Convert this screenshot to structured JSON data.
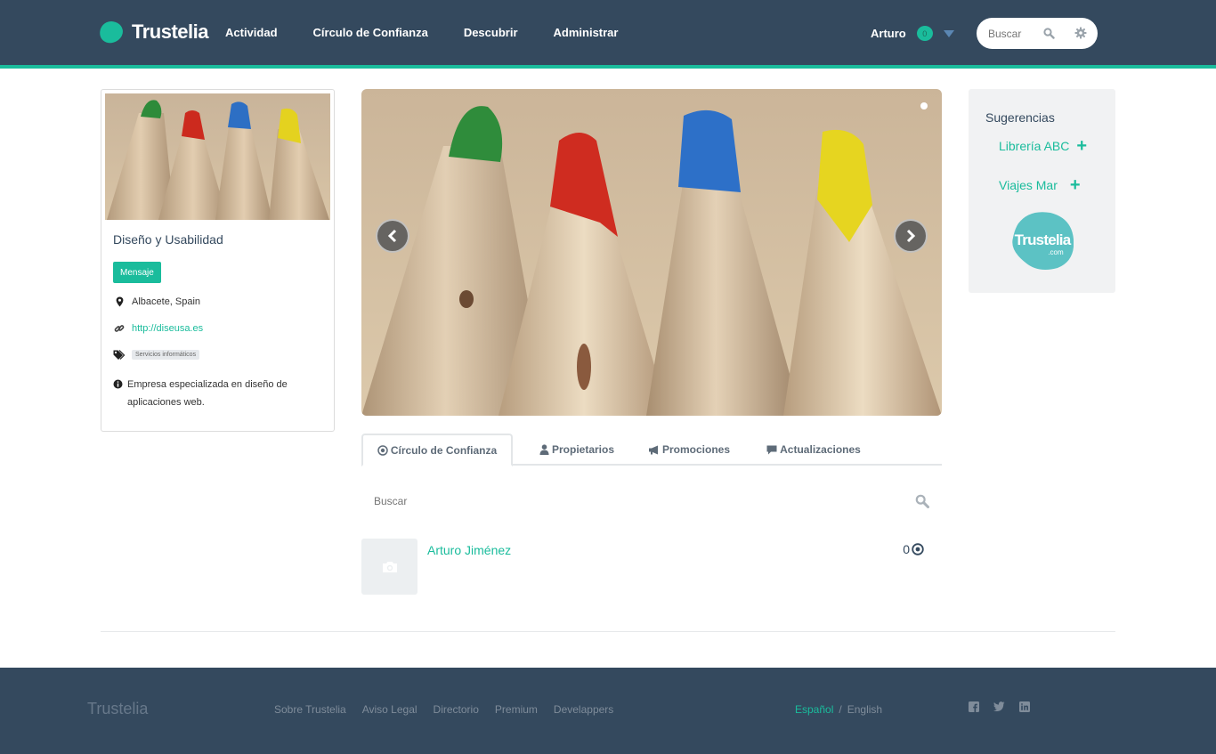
{
  "header": {
    "brand": "Trustelia",
    "nav": [
      "Actividad",
      "Círculo de Confianza",
      "Descubrir",
      "Administrar"
    ],
    "user_name": "Arturo",
    "notification_count": "0",
    "search_placeholder": "Buscar"
  },
  "profile": {
    "title": "Diseño y Usabilidad",
    "message_button": "Mensaje",
    "location": "Albacete, Spain",
    "website": "http://diseusa.es",
    "tag": "Servicios informáticos",
    "description": "Empresa especializada en diseño de aplicaciones web."
  },
  "tabs": [
    {
      "label": "Círculo de Confianza",
      "icon": "target-icon"
    },
    {
      "label": "Propietarios",
      "icon": "user-icon"
    },
    {
      "label": "Promociones",
      "icon": "megaphone-icon"
    },
    {
      "label": "Actualizaciones",
      "icon": "comment-icon"
    }
  ],
  "list": {
    "search_placeholder": "Buscar",
    "members": [
      {
        "name": "Arturo Jiménez",
        "score": "0"
      }
    ]
  },
  "sidebar": {
    "title": "Sugerencias",
    "suggestions": [
      "Librería ABC",
      "Viajes Mar"
    ],
    "logo_text": "Trustelia",
    "logo_sub": ".com"
  },
  "footer": {
    "brand": "Trustelia",
    "links": [
      "Sobre Trustelia",
      "Aviso Legal",
      "Directorio",
      "Premium",
      "Develappers"
    ],
    "lang_active": "Español",
    "lang_sep": "/",
    "lang_other": "English"
  },
  "colors": {
    "navbar": "#34495e",
    "accent": "#1abc9c"
  }
}
